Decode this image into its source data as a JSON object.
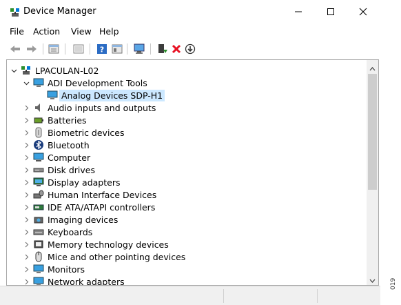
{
  "window": {
    "title": "Device Manager",
    "controls": [
      "minimize",
      "maximize",
      "close"
    ]
  },
  "menu": {
    "items": [
      "File",
      "Action",
      "View",
      "Help"
    ]
  },
  "toolbar": {
    "buttons": [
      "back",
      "forward",
      "properties",
      "show-hidden",
      "help",
      "details",
      "scan-hardware",
      "enable-driver",
      "uninstall-device",
      "update-driver"
    ],
    "colors": {
      "uninstall": "#e81123",
      "enable": "#2d8f2d"
    }
  },
  "tree": {
    "root": "LPACULAN-L02",
    "expanded_category": "ADI Development Tools",
    "selected_device": "Analog Devices SDP-H1",
    "categories": [
      "Audio inputs and outputs",
      "Batteries",
      "Biometric devices",
      "Bluetooth",
      "Computer",
      "Disk drives",
      "Display adapters",
      "Human Interface Devices",
      "IDE ATA/ATAPI controllers",
      "Imaging devices",
      "Keyboards",
      "Memory technology devices",
      "Mice and other pointing devices",
      "Monitors",
      "Network adapters"
    ]
  },
  "figure_label": "019",
  "colors": {
    "selection": "#cce8ff",
    "accent": "#0078d7"
  }
}
